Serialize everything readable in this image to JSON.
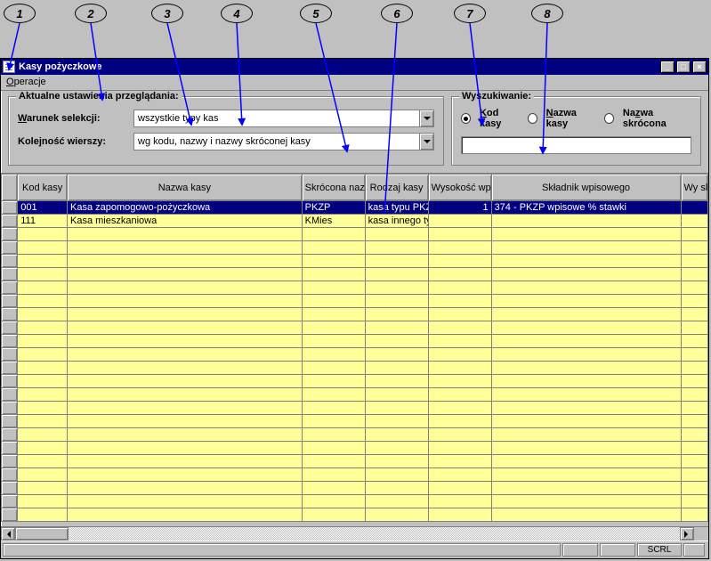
{
  "callouts": [
    "1",
    "2",
    "3",
    "4",
    "5",
    "6",
    "7",
    "8"
  ],
  "window": {
    "title": "Kasy pożyczkowe"
  },
  "menu": {
    "operations": "Operacje"
  },
  "settings_group": {
    "legend": "Aktualne ustawienia przeglądania:",
    "selection_label": "Warunek selekcji:",
    "selection_value": "wszystkie typy kas",
    "order_label": "Kolejność wierszy:",
    "order_value": "wg kodu, nazwy i nazwy skróconej kasy"
  },
  "search_group": {
    "legend": "Wyszukiwanie:",
    "radios": {
      "code": "Kod kasy",
      "name": "Nazwa kasy",
      "short": "Nazwa skrócona"
    },
    "selected": "code",
    "input_value": ""
  },
  "grid": {
    "columns": [
      "Kod kasy",
      "Nazwa kasy",
      "Skrócona nazwa kasy",
      "Rodzaj kasy",
      "Wysokość wpisowego",
      "Składnik wpisowego",
      "Wy sk"
    ],
    "rows": [
      {
        "selected": true,
        "kod": "001",
        "nazwa": "Kasa zapomogowo-pożyczkowa",
        "skrot": "PKZP",
        "rodzaj": "kasa typu PKZ",
        "wysokosc": "1",
        "skladnik": "374 - PKZP wpisowe % stawki",
        "wy": ""
      },
      {
        "selected": false,
        "kod": "111",
        "nazwa": "Kasa mieszkaniowa",
        "skrot": "KMies",
        "rodzaj": "kasa innego ty",
        "wysokosc": "",
        "skladnik": "",
        "wy": ""
      }
    ]
  },
  "status": {
    "scrl": "SCRL"
  }
}
